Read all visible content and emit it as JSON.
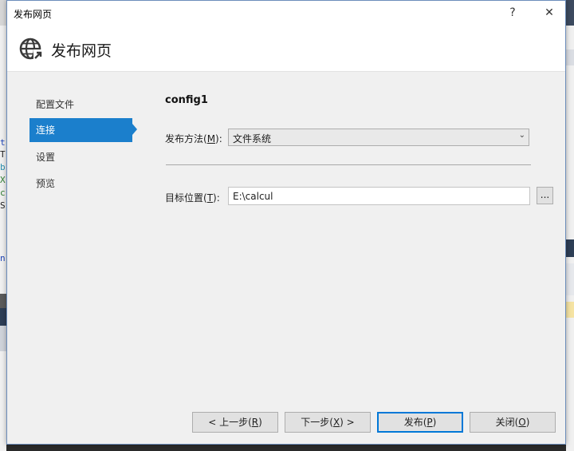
{
  "window": {
    "title": "发布网页",
    "help_glyph": "?",
    "close_glyph": "✕"
  },
  "header": {
    "title": "发布网页",
    "icon": "globe-arrow-icon"
  },
  "nav": {
    "items": [
      {
        "label": "配置文件",
        "active": false
      },
      {
        "label": "连接",
        "active": true
      },
      {
        "label": "设置",
        "active": false
      },
      {
        "label": "预览",
        "active": false
      }
    ]
  },
  "connection": {
    "profile_name": "config1",
    "method_label_pre": "发布方法(",
    "method_label_key": "M",
    "method_label_post": "):",
    "method_value": "文件系统",
    "target_label_pre": "目标位置(",
    "target_label_key": "T",
    "target_label_post": "):",
    "target_value": "E:\\calcul",
    "browse_label": "..."
  },
  "buttons": {
    "prev": {
      "pre": "< 上一步(",
      "key": "R",
      "post": ")"
    },
    "next": {
      "pre": "下一步(",
      "key": "X",
      "post": ") >"
    },
    "publish": {
      "pre": "发布(",
      "key": "P",
      "post": ")"
    },
    "close": {
      "pre": "关闭(",
      "key": "O",
      "post": ")"
    }
  },
  "colors": {
    "accent": "#1b7fcc",
    "dialog_bg": "#f0f0f0",
    "header_bg": "#ffffff"
  }
}
